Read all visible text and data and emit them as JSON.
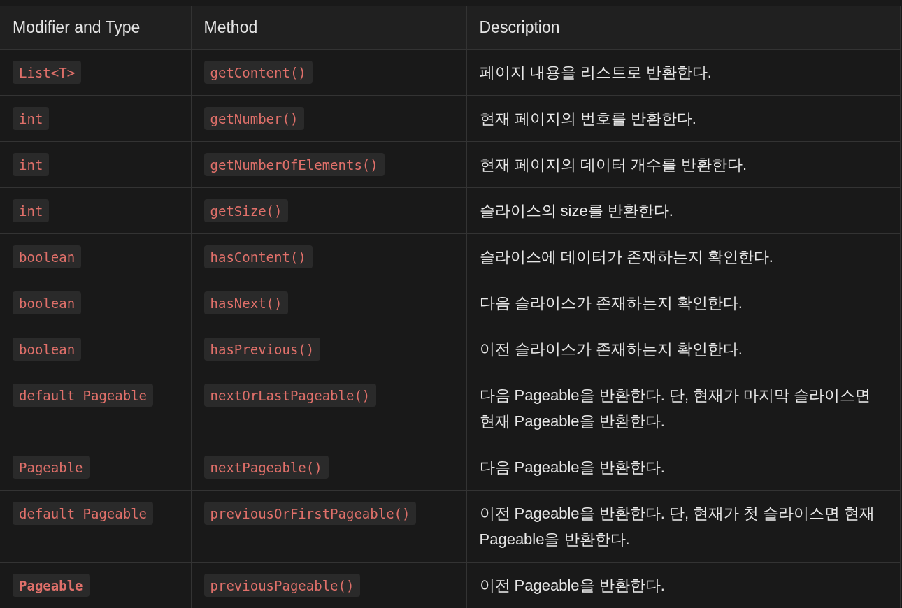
{
  "table": {
    "columns": [
      "Modifier and Type",
      "Method",
      "Description"
    ],
    "rows": [
      {
        "type": "List<T>",
        "type_bold": false,
        "method": "getContent()",
        "description": "페이지 내용을 리스트로 반환한다."
      },
      {
        "type": "int",
        "type_bold": false,
        "method": "getNumber()",
        "description": "현재 페이지의 번호를 반환한다."
      },
      {
        "type": "int",
        "type_bold": false,
        "method": "getNumberOfElements()",
        "description": "현재 페이지의 데이터 개수를 반환한다."
      },
      {
        "type": "int",
        "type_bold": false,
        "method": "getSize()",
        "description": "슬라이스의 size를 반환한다."
      },
      {
        "type": "boolean",
        "type_bold": false,
        "method": "hasContent()",
        "description": "슬라이스에 데이터가 존재하는지 확인한다."
      },
      {
        "type": "boolean",
        "type_bold": false,
        "method": "hasNext()",
        "description": "다음 슬라이스가 존재하는지 확인한다."
      },
      {
        "type": "boolean",
        "type_bold": false,
        "method": "hasPrevious()",
        "description": "이전 슬라이스가 존재하는지 확인한다."
      },
      {
        "type": "default Pageable",
        "type_bold": false,
        "method": "nextOrLastPageable()",
        "description": "다음 Pageable을 반환한다. 단, 현재가 마지막 슬라이스면 현재 Pageable을 반환한다."
      },
      {
        "type": "Pageable",
        "type_bold": false,
        "method": "nextPageable()",
        "description": "다음 Pageable을 반환한다."
      },
      {
        "type": "default Pageable",
        "type_bold": false,
        "method": "previousOrFirstPageable()",
        "description": "이전 Pageable을 반환한다. 단, 현재가 첫 슬라이스면 현재 Pageable을 반환한다."
      },
      {
        "type": "Pageable",
        "type_bold": true,
        "method": "previousPageable()",
        "description": "이전 Pageable을 반환한다."
      }
    ]
  }
}
